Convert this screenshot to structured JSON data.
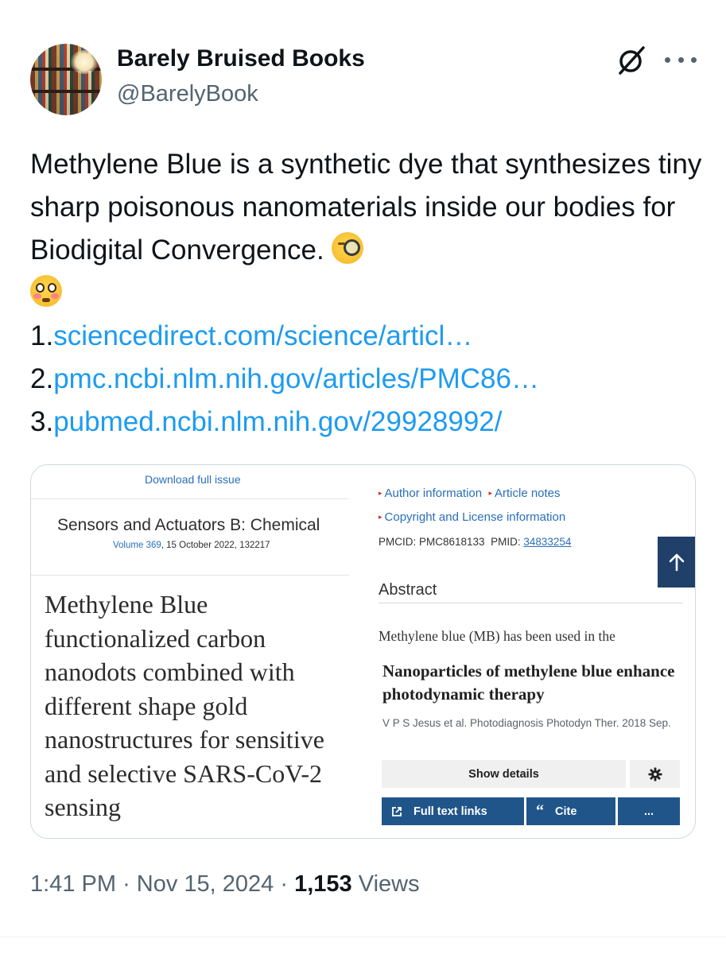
{
  "user": {
    "display_name": "Barely Bruised Books",
    "handle": "@BarelyBook"
  },
  "header_icons": [
    "grok-icon",
    "more-icon"
  ],
  "tweet": {
    "text": "Methylene Blue is a synthetic dye that synthesizes tiny sharp poisonous nanomaterials inside our bodies for Biodigital Convergence.",
    "emojis": [
      "face-with-monocle",
      "flushed-face"
    ],
    "links": [
      {
        "number": "1.",
        "text": "sciencedirect.com/science/articl…"
      },
      {
        "number": "2.",
        "text": "pmc.ncbi.nlm.nih.gov/articles/PMC86…"
      },
      {
        "number": "3.",
        "text": "pubmed.ncbi.nlm.nih.gov/29928992/"
      }
    ]
  },
  "attachment": {
    "left": {
      "download_label": "Download full issue",
      "journal": "Sensors and Actuators B: Chemical",
      "volume_link": "Volume 369",
      "volume_rest": ", 15 October 2022, 132217",
      "title": "Methylene Blue functionalized carbon nanodots combined with different shape gold nanostructures for sensitive and selective SARS-CoV-2 sensing"
    },
    "right": {
      "author_info": "Author information",
      "article_notes": "Article notes",
      "copyright": "Copyright and License information",
      "pmcid_label": "PMCID: PMC8618133",
      "pmid_label": "PMID:",
      "pmid_value": "34833254",
      "abstract_heading": "Abstract",
      "abstract_snippet": "Methylene blue (MB) has been used in the",
      "pub_title": "Nanoparticles of methylene blue enhance photodynamic therapy",
      "citation": "V P S Jesus et al. Photodiagnosis Photodyn Ther. 2018 Sep.",
      "show_details": "Show details",
      "full_text_links": "Full text links",
      "cite": "Cite",
      "more": "...",
      "accent_color": "#20558a"
    }
  },
  "footer": {
    "time": "1:41 PM",
    "separator": "·",
    "date": "Nov 15, 2024",
    "views_count": "1,153",
    "views_label": "Views"
  },
  "colors": {
    "link": "#1d9bf0",
    "secondary_text": "#536471",
    "primary_text": "#0f1419",
    "pubmed_navy": "#20406a"
  }
}
